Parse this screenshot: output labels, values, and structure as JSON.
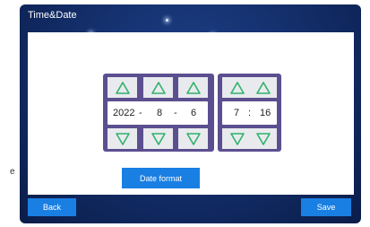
{
  "header": {
    "title": "Time&Date"
  },
  "date": {
    "year": "2022",
    "sep1": "-",
    "month": "8",
    "sep2": "-",
    "day": "6"
  },
  "time": {
    "hour": "7",
    "sep": ":",
    "minute": "16"
  },
  "buttons": {
    "date_format": "Date format",
    "back": "Back",
    "save": "Save"
  },
  "side_mark": "e",
  "colors": {
    "accent": "#1a7fe3",
    "picker": "#5c4f90",
    "arrow": "#2fb26a",
    "background": "#122c66"
  },
  "icons": {
    "up": "up-arrow-icon",
    "down": "down-arrow-icon"
  }
}
